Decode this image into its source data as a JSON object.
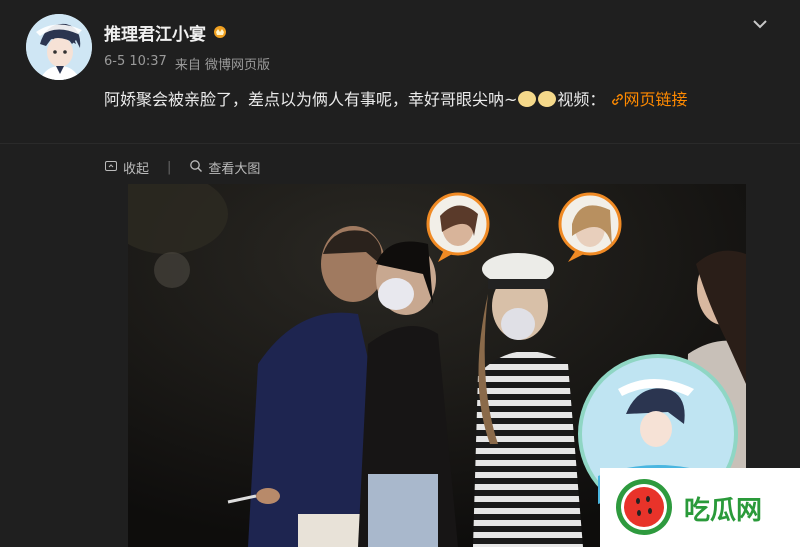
{
  "post": {
    "author": "推理君江小宴",
    "time": "6-5 10:37",
    "source": "来自 微博网页版",
    "text_part1": "阿娇聚会被亲脸了，差点以为俩人有事呢，幸好哥眼尖呐~",
    "text_part2": "视频：",
    "link_text": "网页链接"
  },
  "tools": {
    "collapse": "收起",
    "view_large": "查看大图"
  },
  "watermark": {
    "text": "吃瓜网"
  },
  "colors": {
    "accent": "#ff8a00",
    "background": "#1f1f1f"
  }
}
